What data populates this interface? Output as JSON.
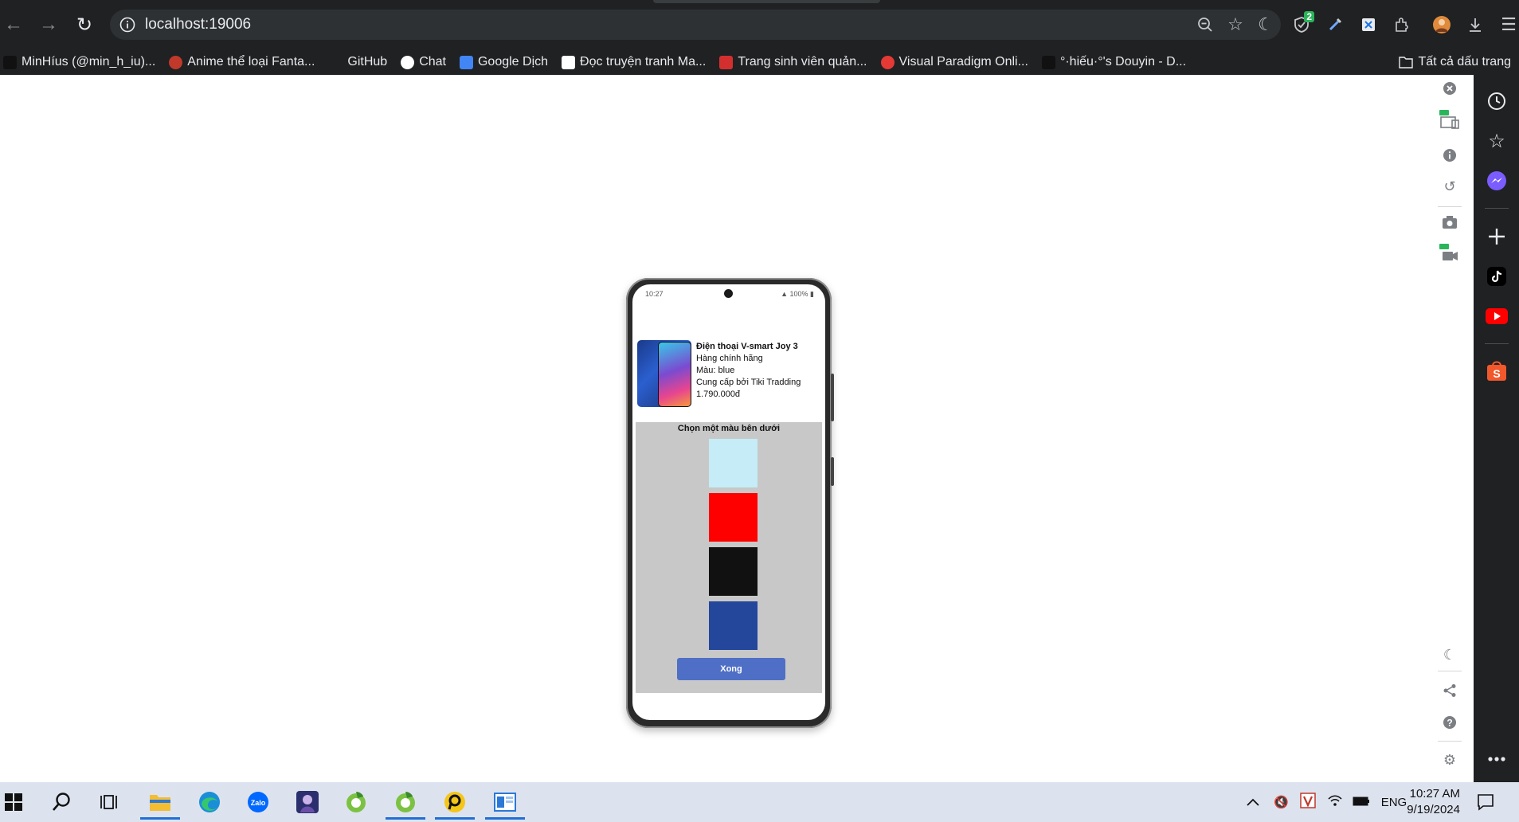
{
  "browser": {
    "url": "localhost:19006",
    "extension_badge": "2",
    "bookmarks": [
      {
        "label": "MinHíus (@min_h_iu)...",
        "color": "#111111"
      },
      {
        "label": "Anime thể loại Fanta...",
        "color": "#c0392b"
      },
      {
        "label": "GitHub",
        "color": ""
      },
      {
        "label": "Chat",
        "color": "#ffffff"
      },
      {
        "label": "Google Dịch",
        "color": "#4285f4"
      },
      {
        "label": "Đọc truyện tranh Ma...",
        "color": "#ffffff"
      },
      {
        "label": "Trang sinh viên quản...",
        "color": "#d32f2f"
      },
      {
        "label": "Visual Paradigm Onli...",
        "color": "#e53935"
      },
      {
        "label": "°·hiếu·°'s Douyin - D...",
        "color": "#111111"
      }
    ],
    "all_bookmarks": "Tất cả dấu trang"
  },
  "phone": {
    "status_time": "10:27",
    "status_battery": "100%",
    "product": {
      "name": "Điện thoại V-smart Joy 3",
      "subtitle": "Hàng chính hãng",
      "color_line": "Màu: blue",
      "seller": "Cung cấp bởi Tiki Tradding",
      "price": "1.790.000đ"
    },
    "picker": {
      "title": "Chọn một màu bên dưới",
      "swatches": [
        {
          "name": "light-blue",
          "color": "#c5ecf7"
        },
        {
          "name": "red",
          "color": "#ff0000"
        },
        {
          "name": "black",
          "color": "#111111"
        },
        {
          "name": "blue",
          "color": "#24469b"
        }
      ],
      "done_label": "Xong"
    }
  },
  "taskbar": {
    "language": "ENG",
    "time": "10:27 AM",
    "date": "9/19/2024"
  }
}
